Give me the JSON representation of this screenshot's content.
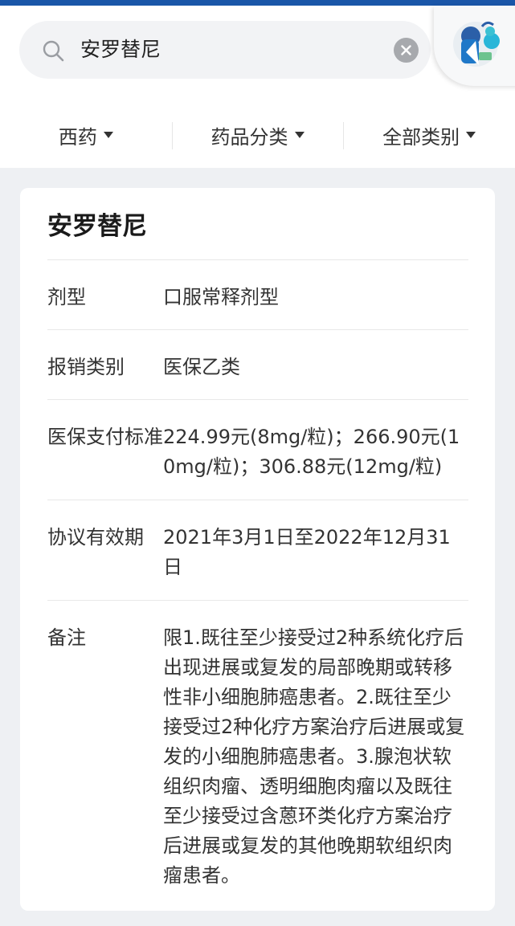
{
  "search": {
    "query": "安罗替尼"
  },
  "filters": [
    {
      "label": "西药"
    },
    {
      "label": "药品分类"
    },
    {
      "label": "全部类别"
    }
  ],
  "card": {
    "title": "安罗替尼",
    "rows": [
      {
        "label": "剂型",
        "value": "口服常释剂型"
      },
      {
        "label": "报销类别",
        "value": "医保乙类"
      },
      {
        "label": "医保支付标准",
        "value": "224.99元(8mg/粒)；266.90元(10mg/粒)；306.88元(12mg/粒)"
      },
      {
        "label": "协议有效期",
        "value": "2021年3月1日至2022年12月31日"
      },
      {
        "label": "备注",
        "value": "限1.既往至少接受过2种系统化疗后出现进展或复发的局部晚期或转移性非小细胞肺癌患者。2.既往至少接受过2种化疗方案治疗后进展或复发的小细胞肺癌患者。3.腺泡状软组织肉瘤、透明细胞肉瘤以及既往至少接受过含蒽环类化疗方案治疗后进展或复发的其他晚期软组织肉瘤患者。"
      }
    ]
  },
  "colors": {
    "accent": "#1a56a8",
    "background": "#eef0f3"
  }
}
